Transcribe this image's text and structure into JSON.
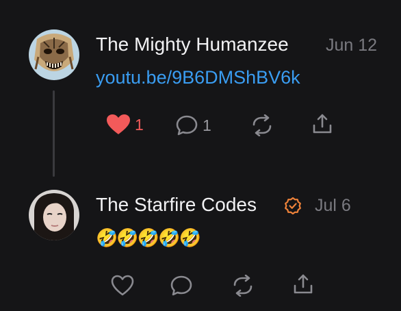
{
  "posts": [
    {
      "author": "The Mighty Humanzee",
      "date": "Jun 12",
      "content": "youtu.be/9B6DMShBV6k",
      "likes": "1",
      "replies": "1",
      "liked": true,
      "avatar_icon": "mask-avatar"
    },
    {
      "author": "The Starfire Codes",
      "date": "Jul 6",
      "verified": true,
      "content": "🤣🤣🤣🤣🤣",
      "liked": false,
      "avatar_icon": "profile-photo-avatar"
    }
  ],
  "colors": {
    "background": "#151517",
    "link": "#3a9df2",
    "like": "#f25a5a",
    "verified": "#f0833a",
    "muted": "#7a7a80"
  }
}
